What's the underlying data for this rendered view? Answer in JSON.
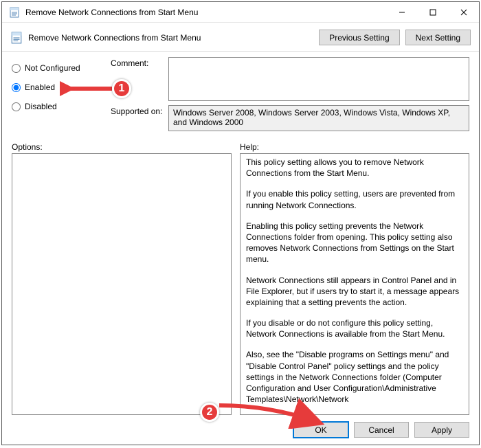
{
  "window": {
    "title": "Remove Network Connections from Start Menu"
  },
  "toolbar": {
    "title": "Remove Network Connections from Start Menu",
    "prev_label": "Previous Setting",
    "next_label": "Next Setting"
  },
  "state": {
    "options": [
      {
        "label": "Not Configured",
        "value": "not_configured"
      },
      {
        "label": "Enabled",
        "value": "enabled"
      },
      {
        "label": "Disabled",
        "value": "disabled"
      }
    ],
    "selected": "enabled"
  },
  "fields": {
    "comment_label": "Comment:",
    "comment_value": "",
    "supported_label": "Supported on:",
    "supported_value": "Windows Server 2008, Windows Server 2003, Windows Vista, Windows XP, and Windows 2000"
  },
  "mid": {
    "options_label": "Options:",
    "help_label": "Help:"
  },
  "help_paragraphs": [
    "This policy setting allows you to remove Network Connections from the Start Menu.",
    "If you enable this policy setting, users are prevented from running Network Connections.",
    "Enabling this policy setting prevents the Network Connections folder from opening. This policy setting also removes Network Connections from Settings on the Start menu.",
    "Network Connections still appears in Control Panel and in File Explorer, but if users try to start it, a message appears explaining that a setting prevents the action.",
    "If you disable or do not configure this policy setting, Network Connections is available from the Start Menu.",
    "Also, see the \"Disable programs on Settings menu\" and \"Disable Control Panel\" policy settings and the policy settings in the Network Connections folder (Computer Configuration and User Configuration\\Administrative Templates\\Network\\Network"
  ],
  "footer": {
    "ok_label": "OK",
    "cancel_label": "Cancel",
    "apply_label": "Apply"
  },
  "annotations": {
    "badge1": "1",
    "badge2": "2"
  }
}
